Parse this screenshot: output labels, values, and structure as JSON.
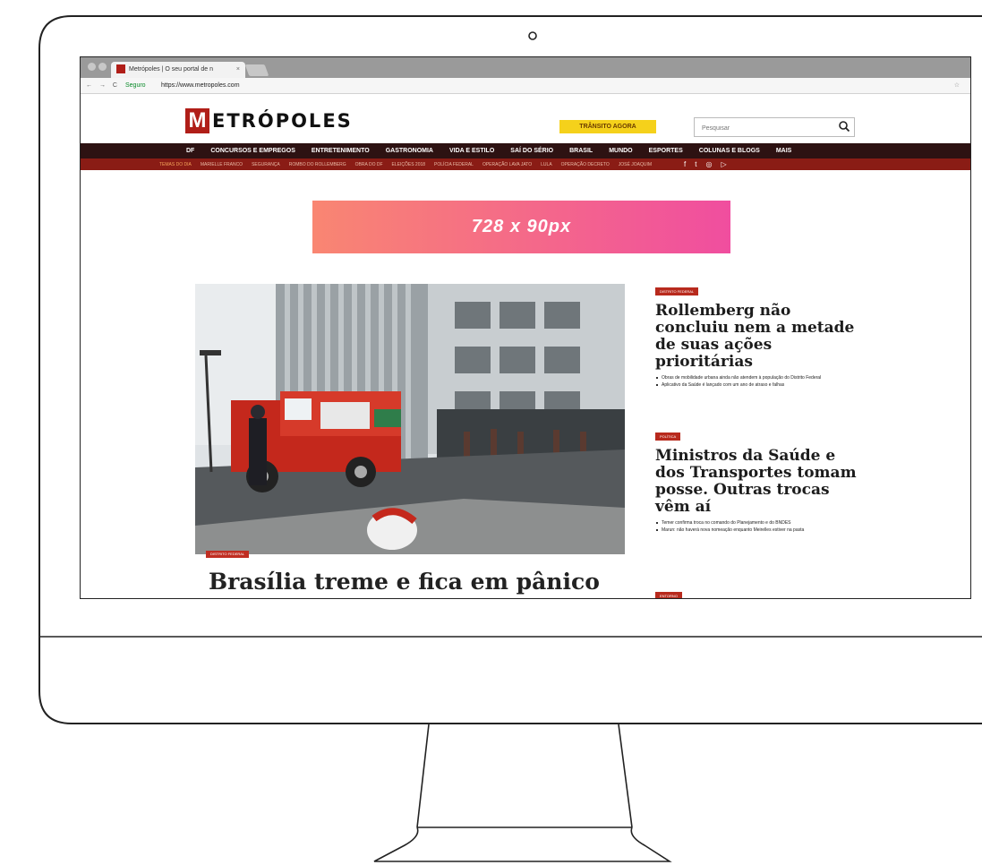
{
  "browser": {
    "tab_title": "Metrópoles | O seu portal de n",
    "tab_close": "×",
    "nav_icons": "← → C",
    "secure_label": "Seguro",
    "url": "https://www.metropoles.com",
    "bookmark_icon": "☆"
  },
  "site": {
    "logo_letter": "M",
    "logo_rest": "ETRÓPOLES",
    "transit_button": "TRÂNSITO AGORA",
    "search_placeholder": "Pesquisar"
  },
  "main_nav": [
    "DF",
    "CONCURSOS E EMPREGOS",
    "ENTRETENIMENTO",
    "GASTRONOMIA",
    "VIDA E ESTILO",
    "SAÍ DO SÉRIO",
    "BRASIL",
    "MUNDO",
    "ESPORTES",
    "COLUNAS E BLOGS",
    "MAIS"
  ],
  "sub_nav": [
    "TEMAS DO DIA",
    "MARIELLE FRANCO",
    "SEGURANÇA",
    "ROMBO DO ROLLEMBERG",
    "OBRA DO DF",
    "ELEIÇÕES 2018",
    "POLÍCIA FEDERAL",
    "OPERAÇÃO LAVA JATO",
    "LULA",
    "OPERAÇÃO DECRETO",
    "JOSÉ JOAQUIM"
  ],
  "social": {
    "facebook": "f",
    "twitter": "t",
    "instagram": "◎",
    "youtube": "▷"
  },
  "ad": {
    "label": "728 x 90px"
  },
  "hero": {
    "badge": "DISTRITO FEDERAL",
    "title": "Brasília treme e fica em pânico"
  },
  "side_stories": [
    {
      "badge": "DISTRITO FEDERAL",
      "title": "Rollemberg não concluiu nem a metade de suas ações prioritárias",
      "bullets": [
        "Obras de mobilidade urbana ainda não atendem à população do Distrito Federal",
        "Aplicativo da Saúde é lançado com um ano de atraso e falhas"
      ]
    },
    {
      "badge": "POLÍTICA",
      "title": "Ministros da Saúde e dos Transportes tomam posse. Outras trocas vêm aí",
      "bullets": [
        "Temer confirma troca no comando do Planejamento e do BNDES",
        "Marun: não haverá nova nomeação enquanto Meirelles estiver na pasta"
      ]
    },
    {
      "badge": "ENTORNO",
      "title": "",
      "bullets": []
    }
  ]
}
